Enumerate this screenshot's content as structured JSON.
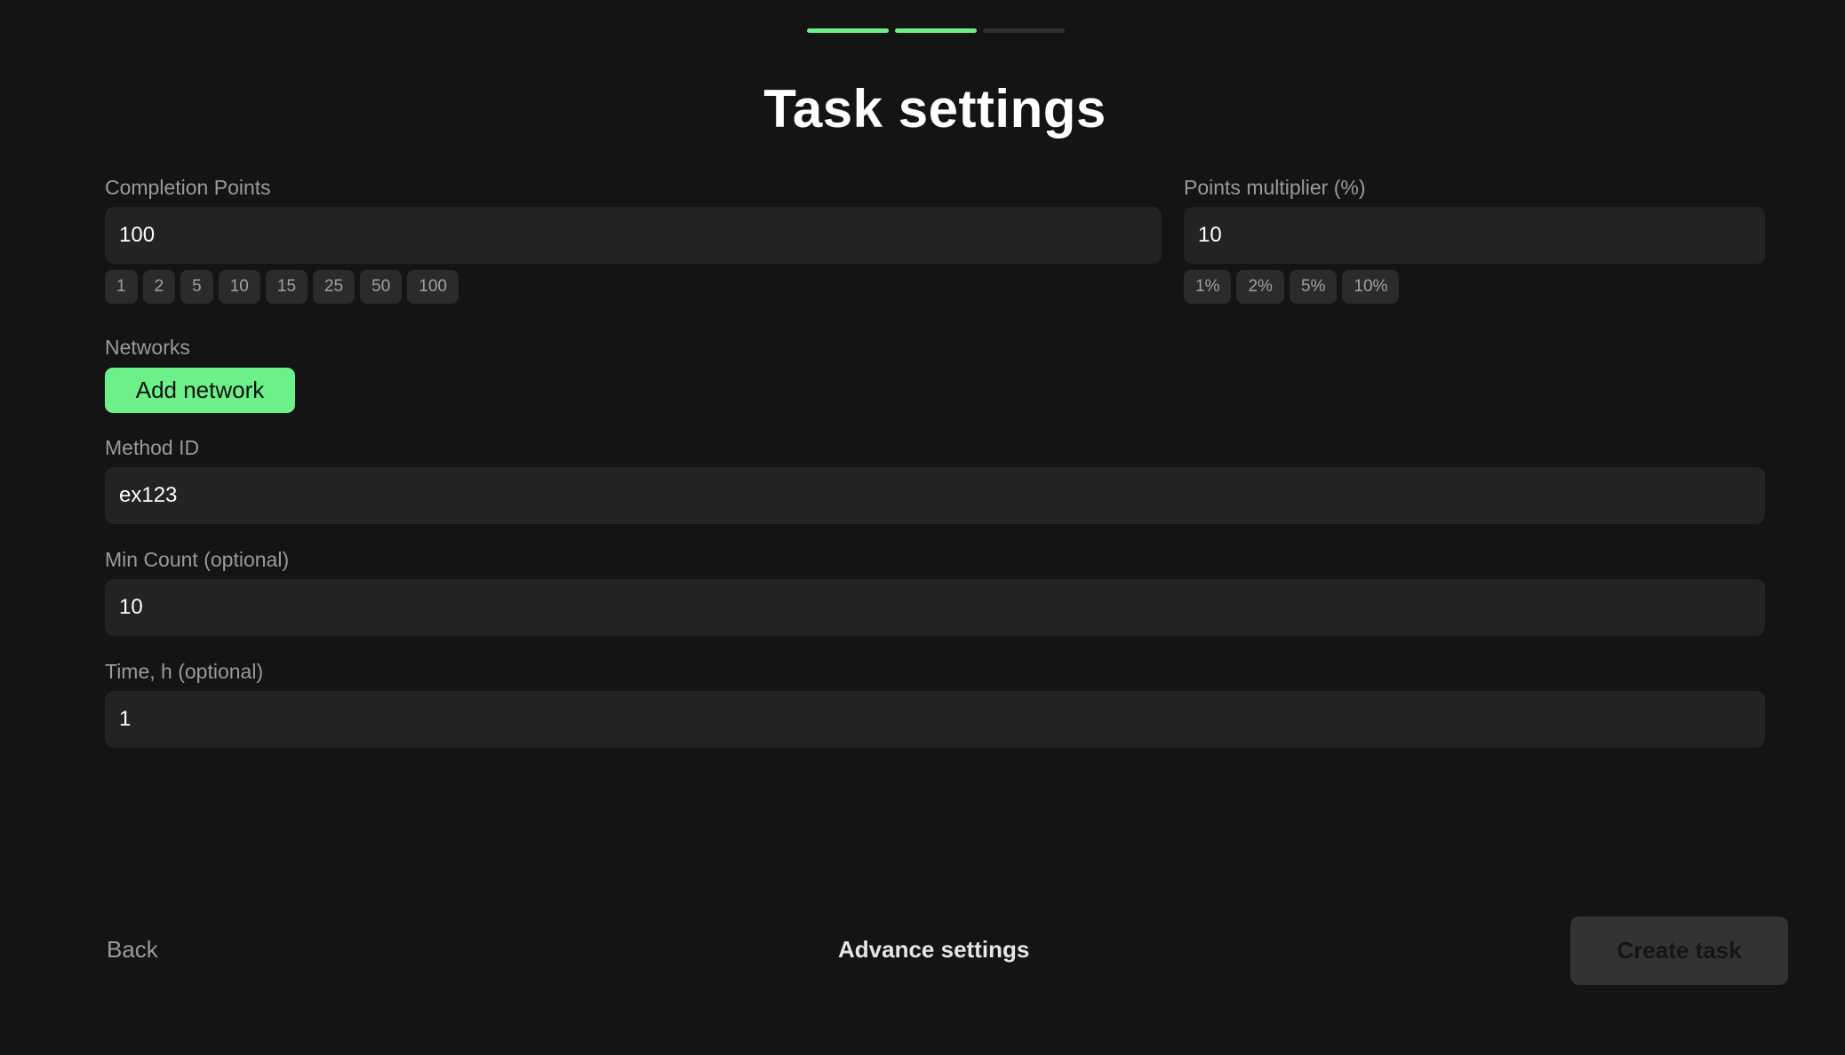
{
  "page": {
    "title": "Task settings",
    "progress": {
      "total_steps": 3,
      "completed_steps": 2
    }
  },
  "completion_points": {
    "label": "Completion Points",
    "value": "100",
    "presets": [
      "1",
      "2",
      "5",
      "10",
      "15",
      "25",
      "50",
      "100"
    ]
  },
  "points_multiplier": {
    "label": "Points multiplier (%)",
    "value": "10",
    "presets": [
      "1%",
      "2%",
      "5%",
      "10%"
    ]
  },
  "networks": {
    "label": "Networks",
    "add_button_label": "Add network"
  },
  "method_id": {
    "label": "Method ID",
    "value": "ex123"
  },
  "min_count": {
    "label": "Min Count (optional)",
    "value": "10"
  },
  "time_hours": {
    "label": "Time, h (optional)",
    "value": "1"
  },
  "footer": {
    "back_label": "Back",
    "advance_label": "Advance settings",
    "create_label": "Create task"
  },
  "colors": {
    "accent": "#6cf08a",
    "background": "#141414",
    "field": "#232323",
    "disabled_button": "#333333"
  }
}
